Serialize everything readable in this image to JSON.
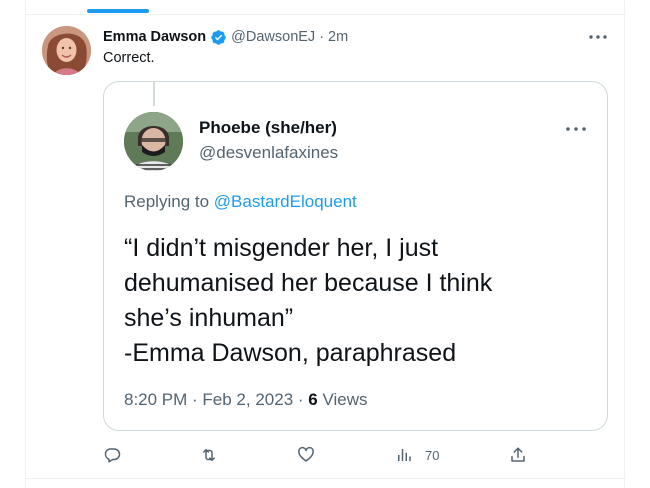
{
  "tweet": {
    "author": {
      "display_name": "Emma Dawson",
      "handle": "@DawsonEJ",
      "verified": true
    },
    "separator": "·",
    "time": "2m",
    "text": "Correct."
  },
  "quote": {
    "author": {
      "display_name": "Phoebe (she/her)",
      "handle": "@desvenlafaxines"
    },
    "replying_prefix": "Replying to",
    "replying_to": "@BastardEloquent",
    "lines": [
      "“I didn’t misgender her, I just",
      "dehumanised her because I think",
      "she’s inhuman”",
      "-Emma Dawson, paraphrased"
    ],
    "timestamp": "8:20 PM · Feb 2, 2023 · ",
    "views_count": "6",
    "views_label": " Views"
  },
  "actions": {
    "reply_icon": "reply-icon",
    "retweet_icon": "retweet-icon",
    "like_icon": "like-icon",
    "views_icon": "views-icon",
    "views_count": "70",
    "share_icon": "share-icon"
  },
  "colors": {
    "accent": "#1d9bf0",
    "secondary_text": "#536471",
    "primary_text": "#0f1419",
    "border": "#cfd9de"
  }
}
